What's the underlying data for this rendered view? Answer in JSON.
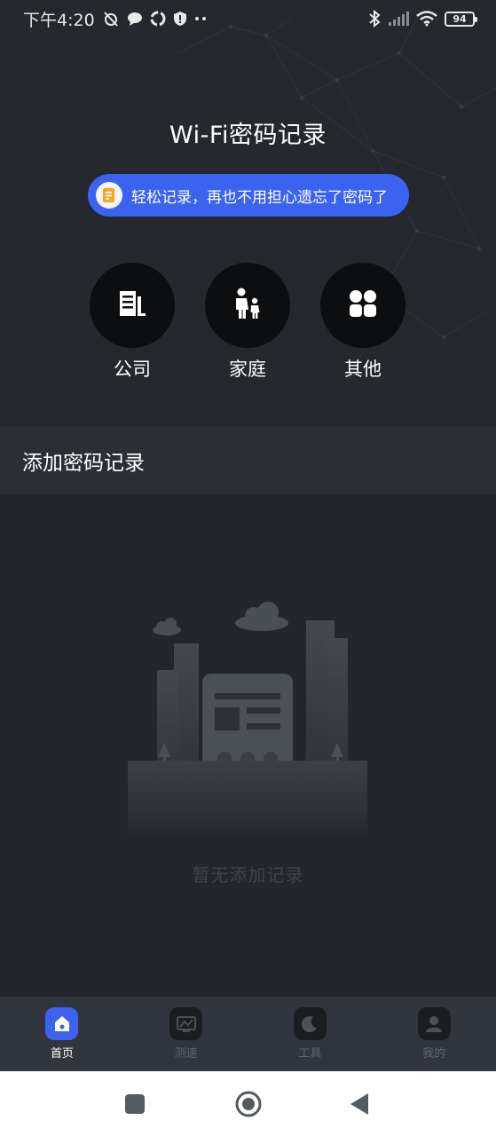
{
  "status_bar": {
    "time": "下午4:20",
    "battery": "94",
    "left_icons": [
      "alarm-off-icon",
      "chat-icon",
      "sync-icon",
      "shield-icon",
      "more-dots-icon"
    ],
    "right_icons": [
      "bluetooth-icon",
      "signal-icon",
      "wifi-icon",
      "battery-icon"
    ]
  },
  "header": {
    "title": "Wi-Fi密码记录",
    "banner_text": "轻松记录，再也不用担心遗忘了密码了",
    "banner_icon": "note-icon"
  },
  "categories": [
    {
      "label": "公司",
      "icon": "building-icon"
    },
    {
      "label": "家庭",
      "icon": "family-icon"
    },
    {
      "label": "其他",
      "icon": "grid-icon"
    }
  ],
  "section": {
    "add_title": "添加密码记录"
  },
  "empty_state": {
    "text": "暂无添加记录",
    "illustration": "empty-city-illustration"
  },
  "tabs": [
    {
      "label": "首页",
      "icon": "home-icon",
      "active": true
    },
    {
      "label": "测速",
      "icon": "speed-icon",
      "active": false
    },
    {
      "label": "工具",
      "icon": "moon-icon",
      "active": false
    },
    {
      "label": "我的",
      "icon": "user-icon",
      "active": false
    }
  ],
  "colors": {
    "accent": "#3b63f0",
    "background": "#23262b",
    "header_bg": "#25282d",
    "tabbar_bg": "#31353d"
  },
  "nav_bar": [
    "square-recent-icon",
    "circle-home-icon",
    "triangle-back-icon"
  ]
}
